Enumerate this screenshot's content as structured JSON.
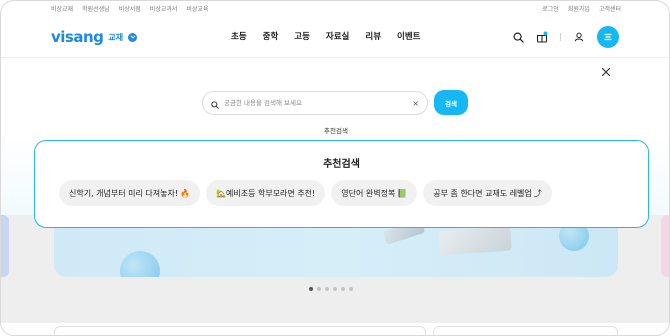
{
  "util_bar": {
    "left_links": [
      "비상교재",
      "학원선생님",
      "비상서점",
      "비상교과서",
      "비상교육"
    ],
    "right_links": [
      "로그인",
      "회원가입",
      "고객센터"
    ]
  },
  "header": {
    "logo_text": "visang",
    "logo_tag": "교재",
    "nav": [
      "초등",
      "중학",
      "고등",
      "자료실",
      "리뷰",
      "이벤트"
    ],
    "icons": [
      "search-icon",
      "gift-icon",
      "user-icon",
      "menu-icon"
    ],
    "accent_color": "#16b8f3"
  },
  "search": {
    "placeholder": "궁금한 내용을 검색해 보세요",
    "value": "",
    "button_label": "검색",
    "clear_symbol": "×",
    "close_symbol": "×"
  },
  "recommend": {
    "tab_label": "추천검색",
    "title": "추천검색",
    "chips": [
      {
        "text": "신학기, 개념부터 미리 다져놓자!",
        "emoji": "🔥"
      },
      {
        "text": "🏡예비초등 학부모라면 추천!",
        "emoji": ""
      },
      {
        "text": "영단어 완벽정복",
        "emoji": "📗"
      },
      {
        "text": "공부 좀 한다면 교재도 레벨업",
        "emoji": "⤴"
      }
    ],
    "border_color": "#27b6ec"
  },
  "carousel": {
    "slide_count": 6,
    "active_index": 0
  }
}
